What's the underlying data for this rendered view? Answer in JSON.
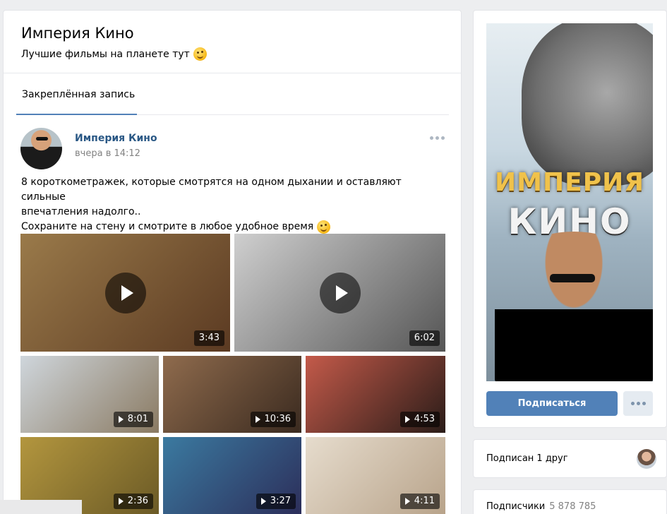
{
  "group": {
    "title": "Империя Кино",
    "status": "Лучшие фильмы на планете тут"
  },
  "tabs": [
    {
      "label": "Закреплённая запись"
    }
  ],
  "post": {
    "author": "Империя Кино",
    "time": "вчера в 14:12",
    "text_lines": [
      "8 короткометражек, которые смотрятся на одном дыхании и оставляют сильные",
      "впечатления надолго..",
      "Сохраните на стену и смотрите в любое удобное время"
    ],
    "videos": [
      {
        "duration": "3:43",
        "colors": [
          "#9a7a4a",
          "#5b3a22"
        ]
      },
      {
        "duration": "6:02",
        "colors": [
          "#cfcfcf",
          "#555555"
        ]
      },
      {
        "duration": "8:01",
        "colors": [
          "#cfd6dc",
          "#8a7a62"
        ]
      },
      {
        "duration": "10:36",
        "colors": [
          "#8f6b4d",
          "#3a2a1f"
        ]
      },
      {
        "duration": "4:53",
        "colors": [
          "#c45a4a",
          "#2a1c18"
        ]
      },
      {
        "duration": "2:36",
        "colors": [
          "#b3963e",
          "#6b5a26"
        ]
      },
      {
        "duration": "3:27",
        "colors": [
          "#3b7aa0",
          "#2c2e5a"
        ]
      },
      {
        "duration": "4:11",
        "colors": [
          "#e6dccd",
          "#b8a38a"
        ]
      }
    ]
  },
  "sidebar": {
    "poster_title_1": "ИМПЕРИЯ",
    "poster_title_2": "КИНО",
    "subscribe_label": "Подписаться",
    "friends_label": "Подписан 1 друг",
    "subscribers_label": "Подписчики",
    "subscribers_count": "5 878 785"
  }
}
